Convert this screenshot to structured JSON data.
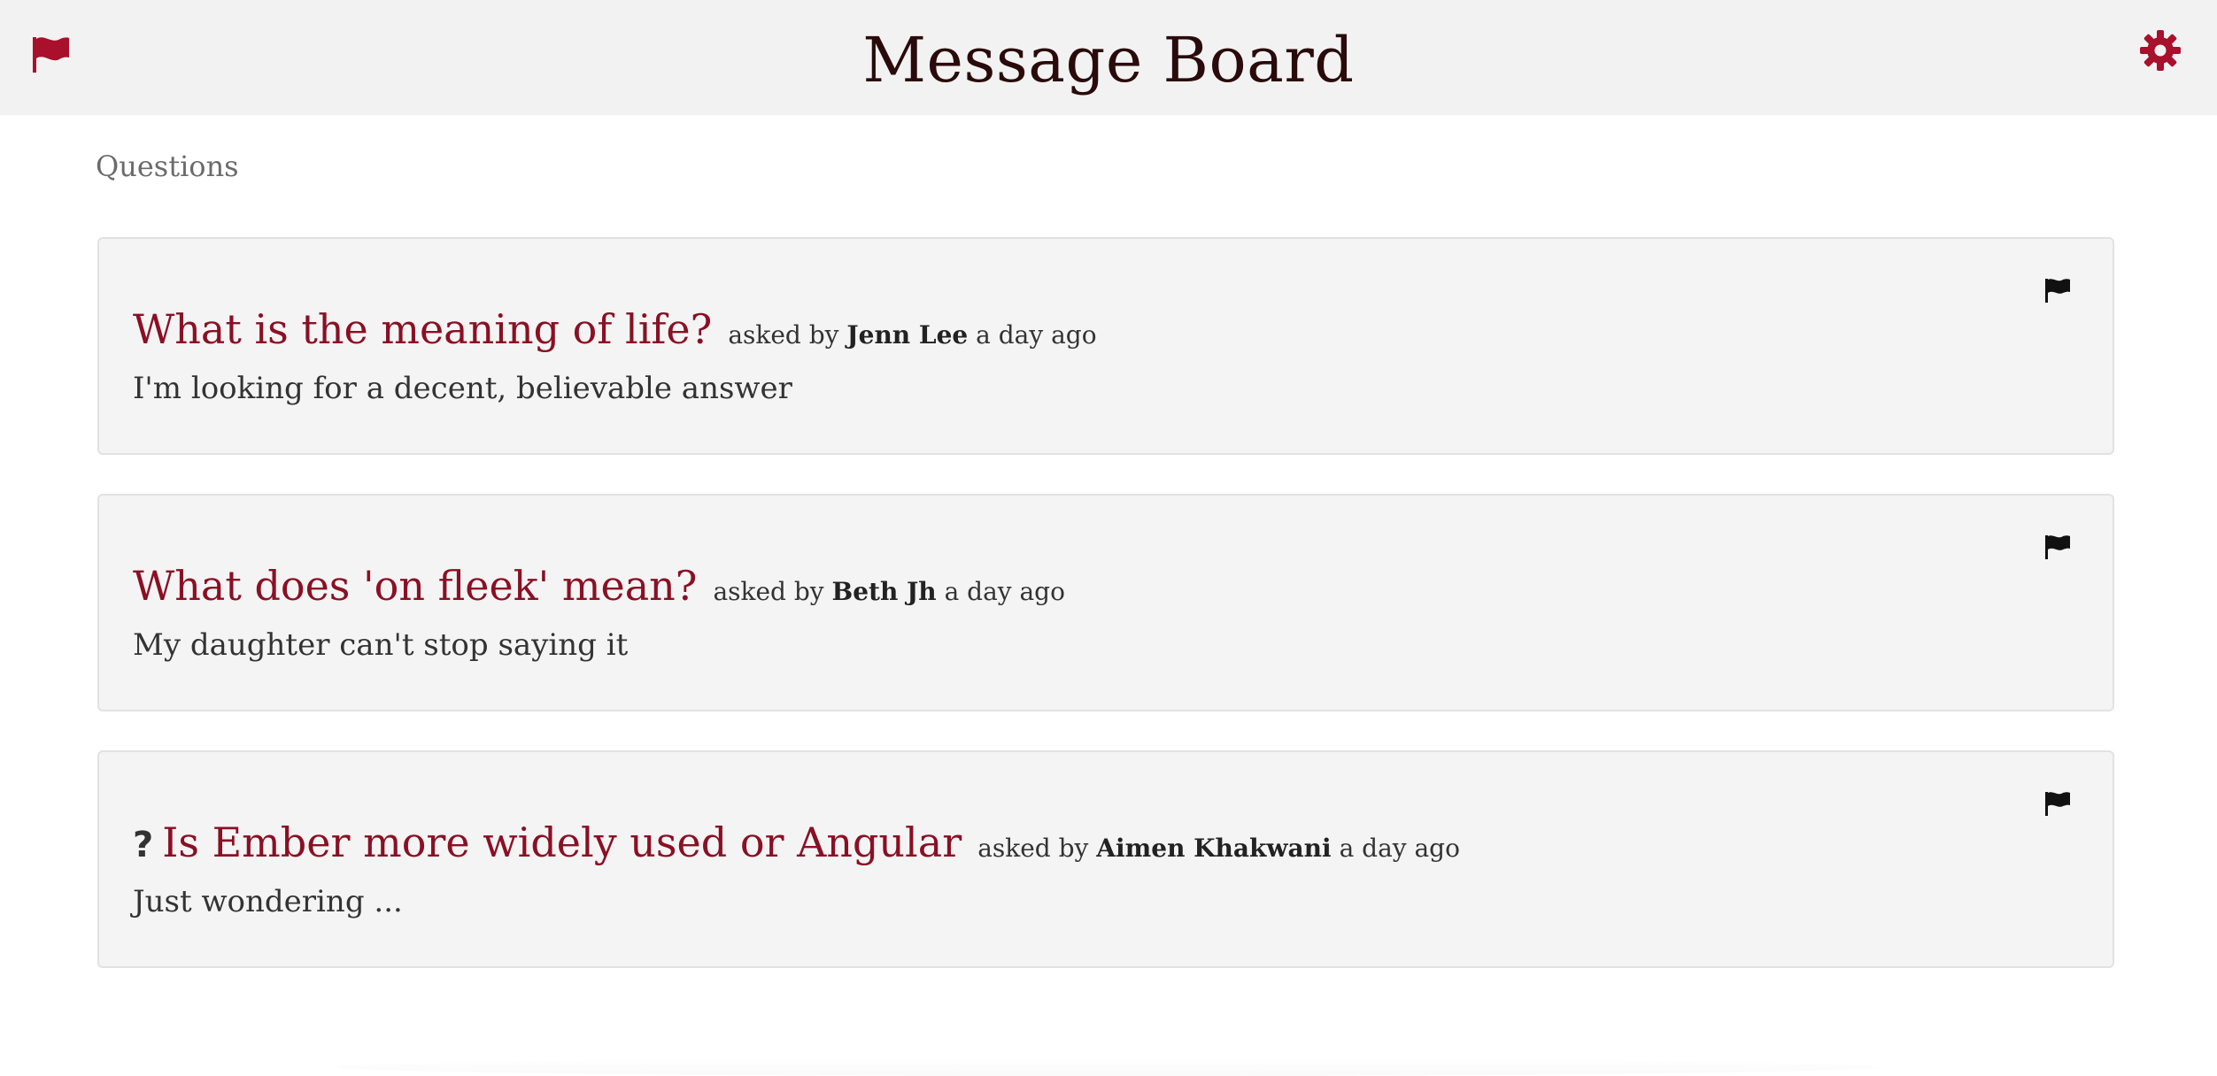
{
  "header": {
    "title": "Message Board",
    "left_icon": "flag-icon",
    "right_icon": "gear-icon",
    "accent_color": "#a8102c"
  },
  "section_label": "Questions",
  "questions": [
    {
      "title": "What is the meaning of life?",
      "asked_by_prefix": "asked by",
      "author": "Jenn Lee",
      "time": "a day ago",
      "body": "I'm looking for a decent, believable answer",
      "has_question_icon": false
    },
    {
      "title": "What does 'on fleek' mean?",
      "asked_by_prefix": "asked by",
      "author": "Beth Jh",
      "time": "a day ago",
      "body": "My daughter can't stop saying it",
      "has_question_icon": false
    },
    {
      "title": "Is Ember more widely used or Angular",
      "asked_by_prefix": "asked by",
      "author": "Aimen Khakwani",
      "time": "a day ago",
      "body": "Just wondering ...",
      "has_question_icon": true,
      "question_icon": "?"
    }
  ]
}
